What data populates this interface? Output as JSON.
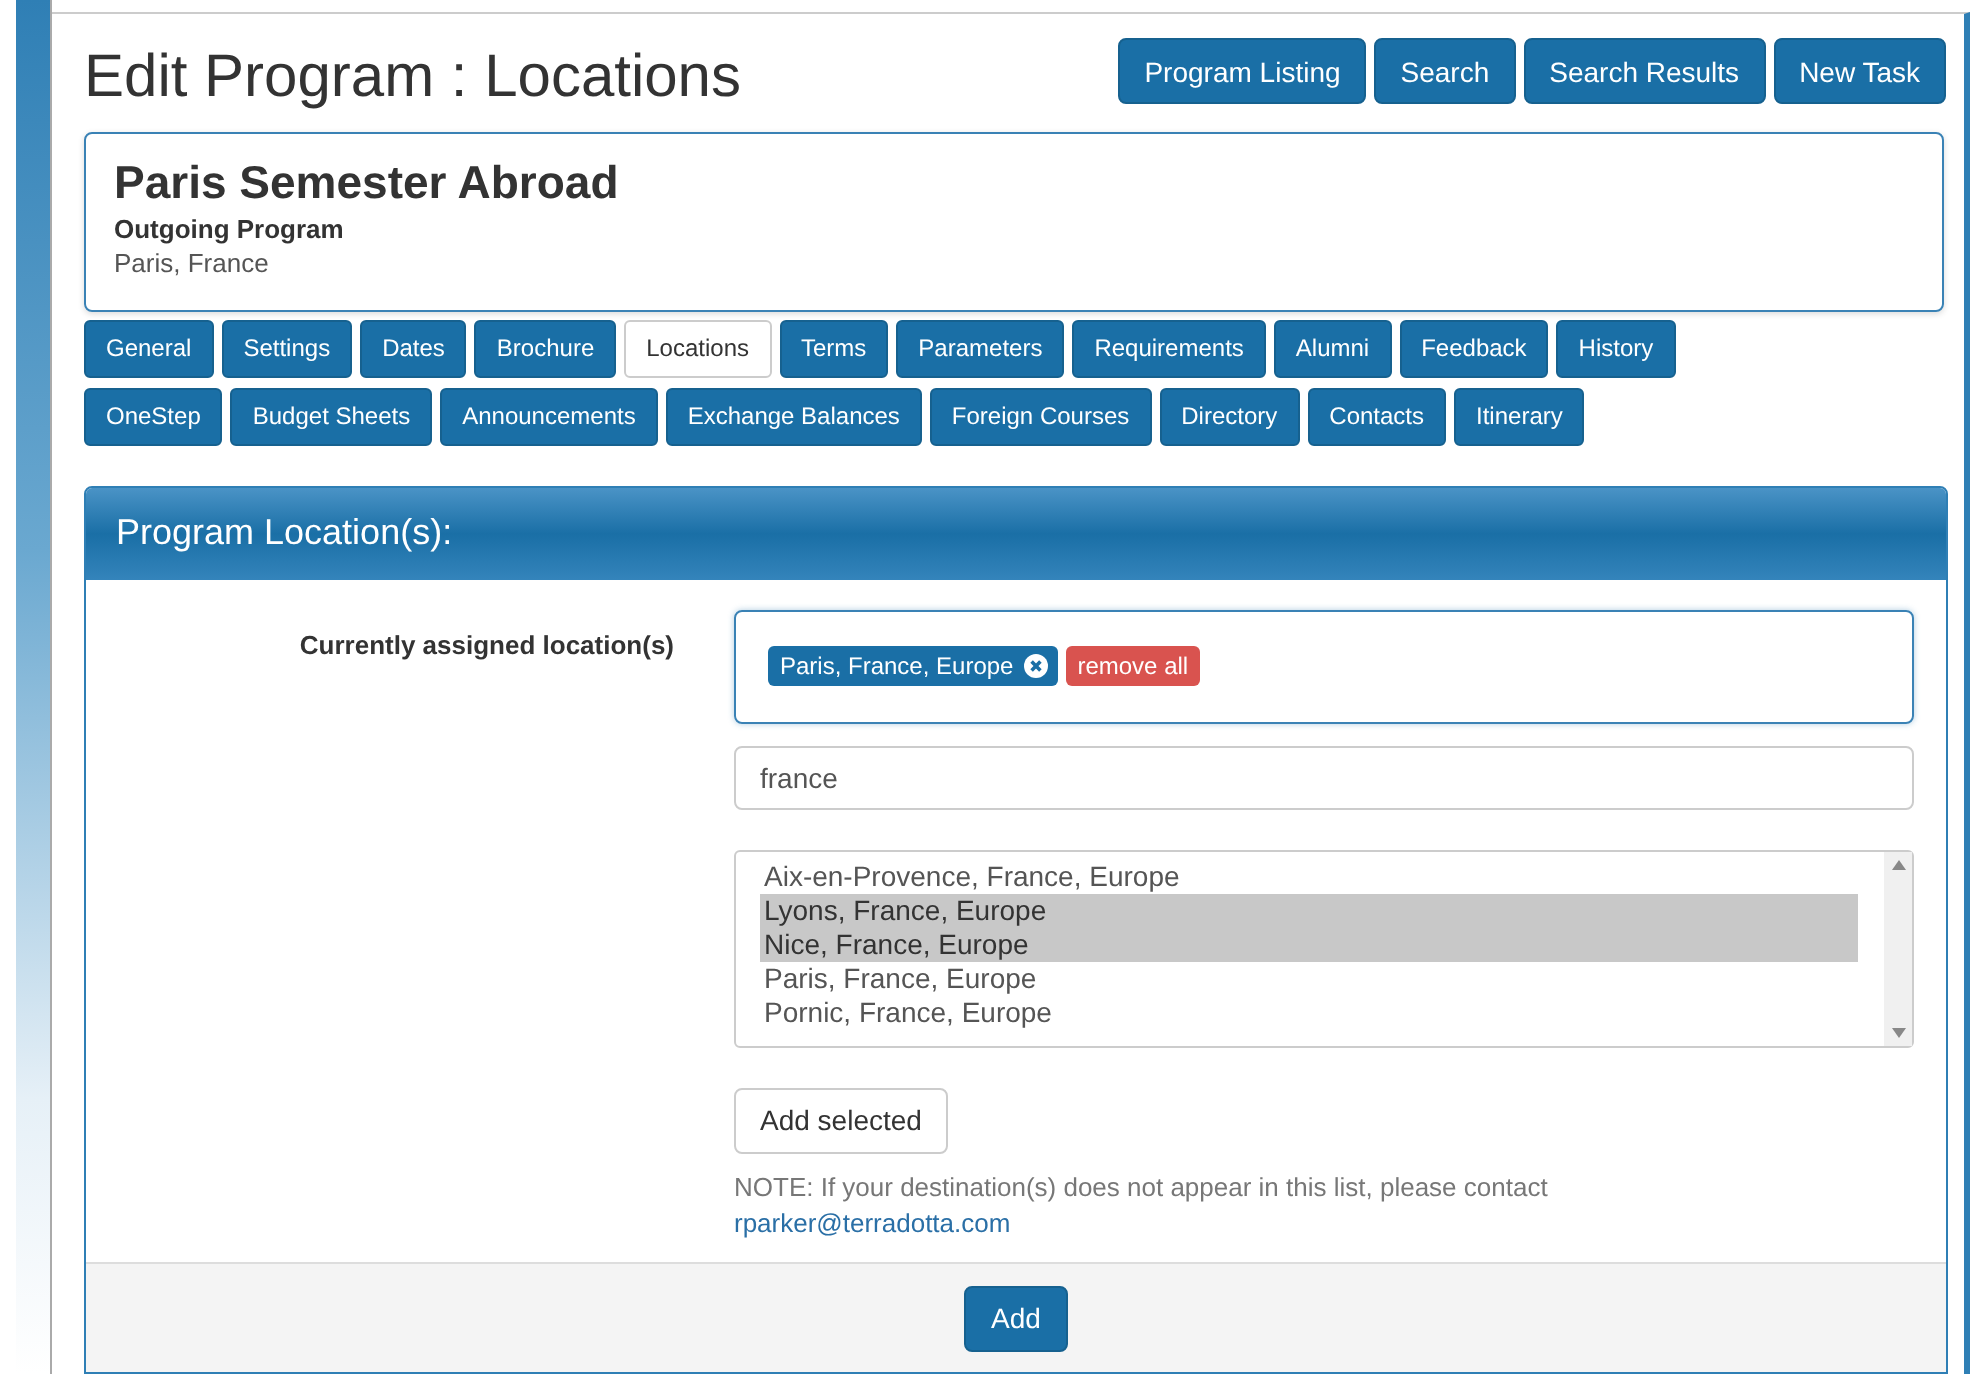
{
  "page": {
    "title": "Edit Program : Locations"
  },
  "nav_buttons": [
    {
      "label": "Program Listing"
    },
    {
      "label": "Search"
    },
    {
      "label": "Search Results"
    },
    {
      "label": "New Task"
    }
  ],
  "program": {
    "name": "Paris Semester Abroad",
    "type": "Outgoing Program",
    "location": "Paris, France"
  },
  "tabs": [
    {
      "label": "General",
      "selected": false
    },
    {
      "label": "Settings",
      "selected": false
    },
    {
      "label": "Dates",
      "selected": false
    },
    {
      "label": "Brochure",
      "selected": false
    },
    {
      "label": "Locations",
      "selected": true
    },
    {
      "label": "Terms",
      "selected": false
    },
    {
      "label": "Parameters",
      "selected": false
    },
    {
      "label": "Requirements",
      "selected": false
    },
    {
      "label": "Alumni",
      "selected": false
    },
    {
      "label": "Feedback",
      "selected": false
    },
    {
      "label": "History",
      "selected": false
    },
    {
      "label": "OneStep",
      "selected": false
    },
    {
      "label": "Budget Sheets",
      "selected": false
    },
    {
      "label": "Announcements",
      "selected": false
    },
    {
      "label": "Exchange Balances",
      "selected": false
    },
    {
      "label": "Foreign Courses",
      "selected": false
    },
    {
      "label": "Directory",
      "selected": false
    },
    {
      "label": "Contacts",
      "selected": false
    },
    {
      "label": "Itinerary",
      "selected": false
    }
  ],
  "panel": {
    "title": "Program Location(s):",
    "field_label": "Currently assigned location(s)",
    "assigned": [
      {
        "label": "Paris, France, Europe"
      }
    ],
    "remove_all": "remove all",
    "search": {
      "value": "france"
    },
    "options": [
      {
        "label": "Aix-en-Provence, France, Europe",
        "selected": false
      },
      {
        "label": "Lyons, France, Europe",
        "selected": true
      },
      {
        "label": "Nice, France, Europe",
        "selected": true
      },
      {
        "label": "Paris, France, Europe",
        "selected": false
      },
      {
        "label": "Pornic, France, Europe",
        "selected": false
      }
    ],
    "add_selected": "Add selected",
    "note": "NOTE: If your destination(s) does not appear in this list, please contact",
    "email": "rparker@terradotta.com",
    "submit": "Add"
  }
}
